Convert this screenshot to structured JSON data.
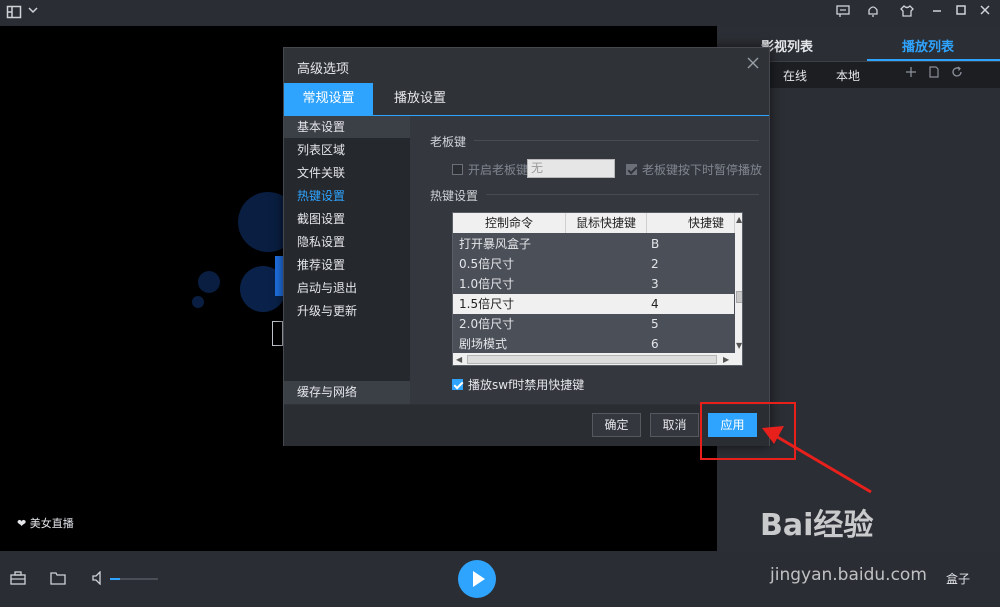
{
  "titlebar": {
    "icons": [
      "menu-icon",
      "chevron-down-icon",
      "message-icon",
      "bell-icon",
      "skin-icon",
      "minimize-icon",
      "maximize-icon",
      "close-icon"
    ]
  },
  "right_panel": {
    "tabs": [
      "影视列表",
      "播放列表"
    ],
    "active_tab": "播放列表",
    "subtabs": [
      "在线",
      "本地"
    ],
    "sub_icons": [
      "add-icon",
      "file-icon",
      "refresh-icon"
    ]
  },
  "live_badge": "美女直播",
  "bottom_bar": {
    "right_label": "盒子"
  },
  "dialog": {
    "title": "高级选项",
    "tabs": [
      "常规设置",
      "播放设置"
    ],
    "sidebar": [
      {
        "label": "基本设置",
        "state": "selected"
      },
      {
        "label": "列表区域",
        "state": ""
      },
      {
        "label": "文件关联",
        "state": ""
      },
      {
        "label": "热键设置",
        "state": "active"
      },
      {
        "label": "截图设置",
        "state": ""
      },
      {
        "label": "隐私设置",
        "state": ""
      },
      {
        "label": "推荐设置",
        "state": ""
      },
      {
        "label": "启动与退出",
        "state": ""
      },
      {
        "label": "升级与更新",
        "state": ""
      }
    ],
    "sidebar_bottom": "缓存与网络",
    "boss_key": {
      "group_label": "老板键",
      "enable_label": "开启老板键",
      "input_value": "无",
      "pause_label": "老板键按下时暂停播放"
    },
    "hotkeys": {
      "group_label": "热键设置",
      "columns": [
        "控制命令",
        "鼠标快捷键",
        "快捷键"
      ],
      "rows": [
        {
          "command": "打开暴风盒子",
          "mouse": "",
          "key": "B"
        },
        {
          "command": "0.5倍尺寸",
          "mouse": "",
          "key": "2"
        },
        {
          "command": "1.0倍尺寸",
          "mouse": "",
          "key": "3"
        },
        {
          "command": "1.5倍尺寸",
          "mouse": "",
          "key": "4"
        },
        {
          "command": "2.0倍尺寸",
          "mouse": "",
          "key": "5"
        },
        {
          "command": "剧场模式",
          "mouse": "",
          "key": "6"
        }
      ],
      "selected_row": "1.5倍尺寸",
      "swf_label": "播放swf时禁用快捷键"
    },
    "buttons": {
      "ok": "确定",
      "cancel": "取消",
      "apply": "应用"
    }
  },
  "watermark": {
    "brand": "Bai经验",
    "url": "jingyan.baidu.com"
  },
  "colors": {
    "accent": "#2fa4ff",
    "annotation": "#e8201c"
  }
}
